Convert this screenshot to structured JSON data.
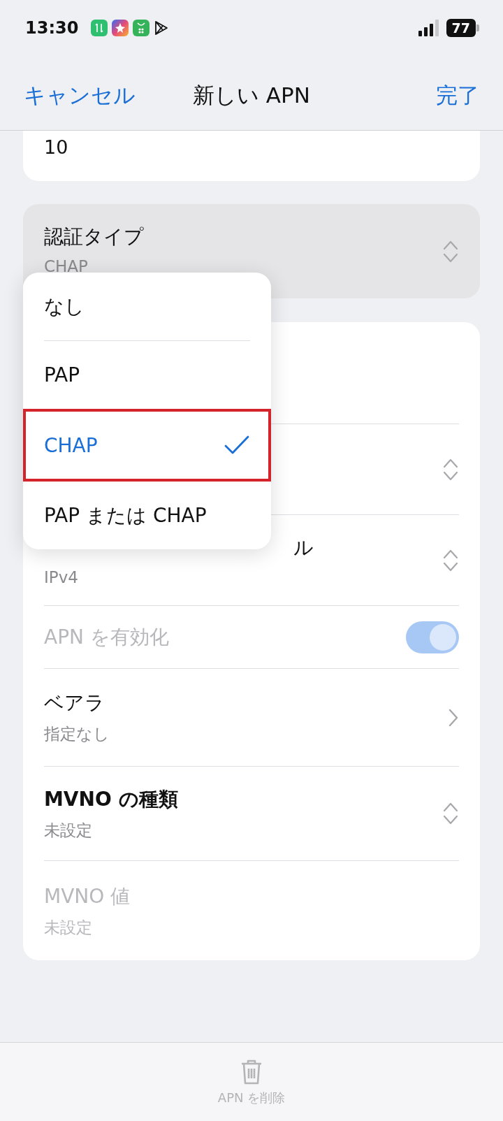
{
  "status_bar": {
    "time": "13:30",
    "battery": "77"
  },
  "nav": {
    "cancel": "キャンセル",
    "title": "新しい APN",
    "done": "完了"
  },
  "top_card": {
    "value": "10"
  },
  "auth_row": {
    "label": "認証タイプ",
    "value": "CHAP"
  },
  "rows": [
    {
      "kind": "covered"
    },
    {
      "kind": "covered_select"
    },
    {
      "kind": "select_covered",
      "label": "ル",
      "value": "IPv4",
      "disabled": false
    },
    {
      "kind": "toggle",
      "label": "APN を有効化",
      "on": true,
      "disabled": true
    },
    {
      "kind": "link",
      "label": "ベアラ",
      "value": "指定なし",
      "disabled": false
    },
    {
      "kind": "select",
      "label": "MVNO の種類",
      "value": "未設定",
      "disabled": false,
      "bold": true
    },
    {
      "kind": "plain",
      "label": "MVNO 値",
      "value": "未設定",
      "disabled": true
    }
  ],
  "menu": [
    {
      "label": "なし",
      "selected": false,
      "highlighted": false
    },
    {
      "label": "PAP",
      "selected": false,
      "highlighted": false
    },
    {
      "label": "CHAP",
      "selected": true,
      "highlighted": true
    },
    {
      "label": "PAP または CHAP",
      "selected": false,
      "highlighted": false
    }
  ],
  "bottom": {
    "delete": "APN を削除"
  }
}
